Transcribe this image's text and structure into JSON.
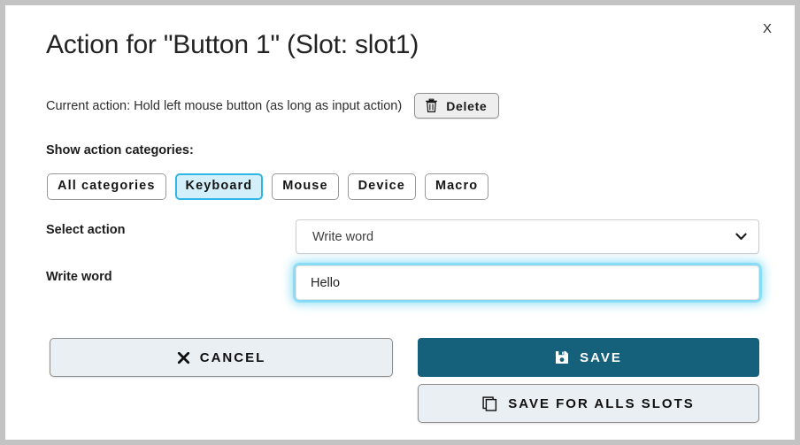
{
  "dialog": {
    "title": "Action for \"Button 1\" (Slot: slot1)",
    "close_label": "X",
    "border_color": "#c3c3c3",
    "background": "#ffffff"
  },
  "current_action": {
    "text": "Current action: Hold left mouse button (as long as input action)",
    "delete_label": "Delete",
    "delete_icon": "trash-icon"
  },
  "categories": {
    "heading": "Show action categories:",
    "items": [
      {
        "label": "All categories",
        "selected": false
      },
      {
        "label": "Keyboard",
        "selected": true
      },
      {
        "label": "Mouse",
        "selected": false
      },
      {
        "label": "Device",
        "selected": false
      },
      {
        "label": "Macro",
        "selected": false
      }
    ],
    "selected_bg": "#d2effa",
    "selected_border": "#2fb5e8"
  },
  "form": {
    "select_action_label": "Select action",
    "select_action_value": "Write word",
    "select_action_options": [
      "Write word"
    ],
    "select_chevron_icon": "chevron-down-icon",
    "write_word_label": "Write word",
    "write_word_value": "Hello",
    "write_word_placeholder": "",
    "focus_glow_color": "#40c8f0"
  },
  "footer": {
    "cancel_label": "CANCEL",
    "cancel_icon": "close-x-icon",
    "save_label": "SAVE",
    "save_icon": "floppy-save-icon",
    "save_color": "#15607a",
    "save_all_label": "SAVE FOR ALLS SLOTS",
    "save_all_icon": "copy-icon"
  }
}
